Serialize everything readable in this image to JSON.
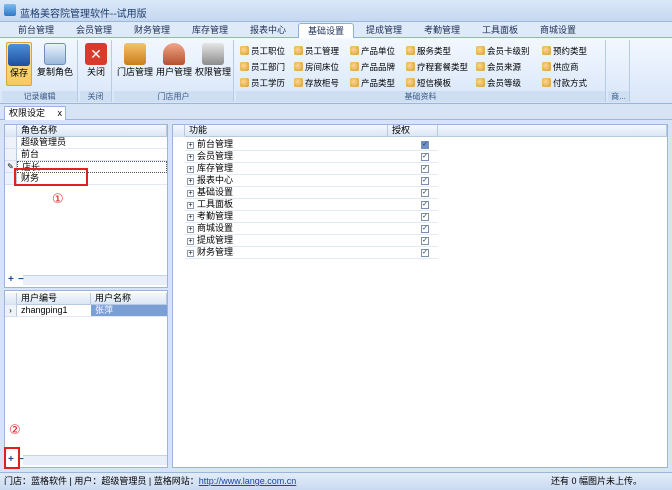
{
  "window": {
    "title": "蓝格美容院管理软件--试用版"
  },
  "menu": {
    "tabs": [
      "前台管理",
      "会员管理",
      "财务管理",
      "库存管理",
      "报表中心",
      "基础设置",
      "提成管理",
      "考勤管理",
      "工具面板",
      "商城设置"
    ],
    "active": "基础设置"
  },
  "ribbon": {
    "records": {
      "save": "保存",
      "copy_role": "复制角色",
      "label": "记录编辑"
    },
    "close": {
      "close": "关闭",
      "label": "关闭"
    },
    "store_users": {
      "store_mgmt": "门店管理",
      "user_mgmt": "用户管理",
      "perm_mgmt": "权限管理",
      "label": "门店用户"
    },
    "basic": {
      "items": [
        "员工职位",
        "员工管理",
        "产品单位",
        "服务类型",
        "会员卡级别",
        "预约类型",
        "员工部门",
        "房间床位",
        "产品品牌",
        "疗程套餐类型",
        "会员来源",
        "供应商",
        "员工学历",
        "存放柜号",
        "产品类型",
        "短信模板",
        "会员等级",
        "付款方式"
      ],
      "label": "基础资料"
    },
    "more": {
      "label": "商..."
    }
  },
  "doc_tab": {
    "title": "权限设定",
    "close": "x"
  },
  "roles": {
    "header": "角色名称",
    "items": [
      "超级管理员",
      "前台",
      "店长",
      "财务"
    ],
    "selected": "店长",
    "add": "+",
    "remove": "−"
  },
  "users": {
    "headers": [
      "用户编号",
      "用户名称"
    ],
    "rows": [
      {
        "id": "zhangping1",
        "name": "张萍"
      }
    ],
    "add": "+",
    "remove": "−"
  },
  "functions": {
    "headers": [
      "功能",
      "授权"
    ],
    "rows": [
      {
        "name": "前台管理",
        "auth": true
      },
      {
        "name": "会员管理",
        "auth": true
      },
      {
        "name": "库存管理",
        "auth": true
      },
      {
        "name": "报表中心",
        "auth": true
      },
      {
        "name": "基础设置",
        "auth": true
      },
      {
        "name": "工具面板",
        "auth": true
      },
      {
        "name": "考勤管理",
        "auth": true
      },
      {
        "name": "商城设置",
        "auth": true
      },
      {
        "name": "提成管理",
        "auth": true
      },
      {
        "name": "财务管理",
        "auth": true
      }
    ]
  },
  "annotations": {
    "one": "①",
    "two": "②"
  },
  "status": {
    "store": "门店：蓝格软件",
    "user": "用户：超级管理员",
    "site_label": "蓝格网站：",
    "site": "http://www.lange.com.cn",
    "right": "还有 0 幅图片未上传。"
  },
  "colors": {
    "selected_row": "#7a9fd6",
    "accent": "#2f5f9e",
    "annotation": "#e02020"
  }
}
